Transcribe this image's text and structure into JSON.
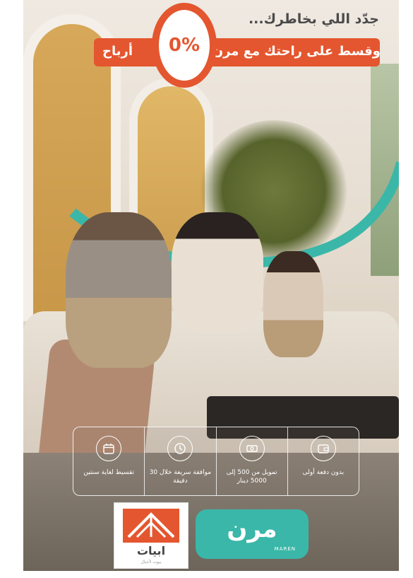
{
  "headline": {
    "line1": "جدّد اللي بخاطرك...",
    "banner_right": "وقسط على راحتك مع مرن",
    "percent": "0%",
    "banner_left": "أرباح"
  },
  "features": [
    {
      "icon": "calendar-icon",
      "text": "تقسيط لغاية سنتين"
    },
    {
      "icon": "clock-icon",
      "text": "موافقة سريعة خلال 30 دقيقة"
    },
    {
      "icon": "money-icon",
      "text": "تمويل من 500 إلى 5000 دينار"
    },
    {
      "icon": "wallet-icon",
      "text": "بدون دفعة أولى"
    }
  ],
  "logos": {
    "abyat_name": "ابيات",
    "abyat_tagline": "بيوت لأجيال",
    "maren_ar": "مرن",
    "maren_en": "MAREN"
  },
  "colors": {
    "accent_orange": "#e4562f",
    "teal": "#3ab7a8"
  }
}
